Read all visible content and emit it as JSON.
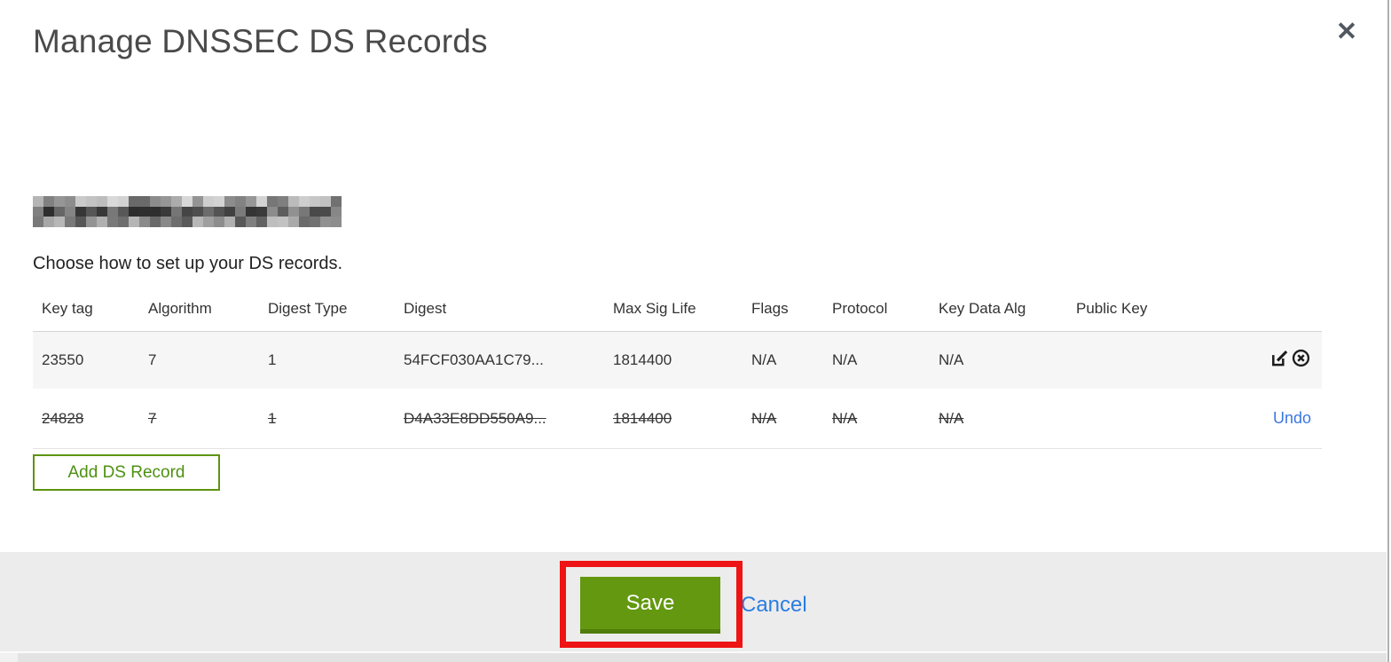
{
  "modal": {
    "title": "Manage DNSSEC DS Records",
    "close_icon": "✕",
    "intro": "Choose how to set up your DS records."
  },
  "table": {
    "columns": [
      "Key tag",
      "Algorithm",
      "Digest Type",
      "Digest",
      "Max Sig Life",
      "Flags",
      "Protocol",
      "Key Data Alg",
      "Public Key"
    ],
    "rows": [
      {
        "state": "active",
        "cells": [
          "23550",
          "7",
          "1",
          "54FCF030AA1C79...",
          "1814400",
          "N/A",
          "N/A",
          "N/A",
          ""
        ],
        "actions": [
          "edit",
          "delete"
        ]
      },
      {
        "state": "deleted",
        "cells": [
          "24828",
          "7",
          "1",
          "D4A33E8DD550A9...",
          "1814400",
          "N/A",
          "N/A",
          "N/A",
          ""
        ],
        "undo_label": "Undo"
      }
    ]
  },
  "buttons": {
    "add_ds_record": "Add DS Record",
    "save": "Save",
    "cancel": "Cancel"
  },
  "colors": {
    "accent_green": "#639810",
    "outline_green": "#5d9410",
    "link_blue": "#2a7de2",
    "undo_blue": "#3b77e0",
    "annotation_red": "#ee1314",
    "footer_gray": "#ececec",
    "row_gray": "#f6f6f6"
  }
}
